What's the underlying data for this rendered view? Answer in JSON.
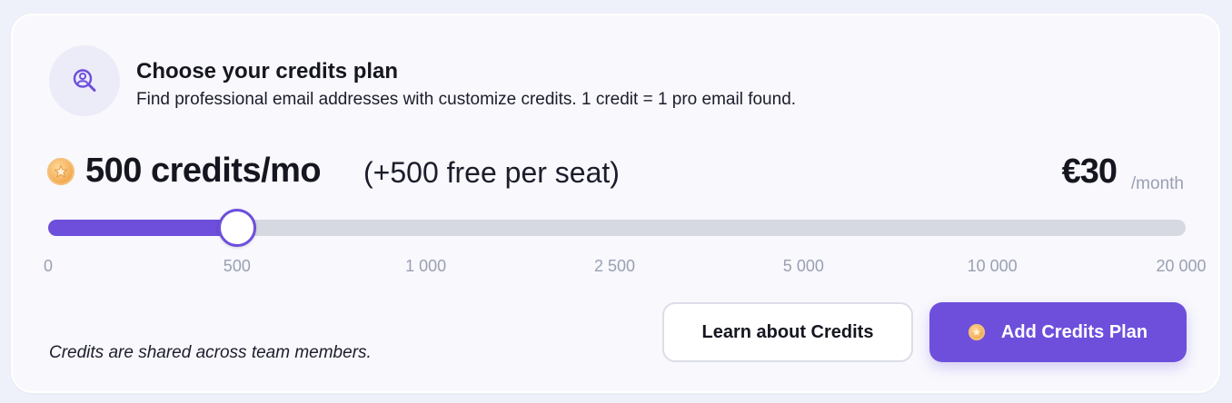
{
  "header": {
    "title": "Choose your credits plan",
    "subtitle": "Find professional email addresses with customize credits. 1 credit = 1 pro email found."
  },
  "plan": {
    "credits": "500 credits/mo",
    "free_per_seat": "(+500 free per seat)",
    "price": "€30",
    "period": "/month"
  },
  "slider": {
    "ticks": [
      "0",
      "500",
      "1 000",
      "2 500",
      "5 000",
      "10 000",
      "20 000"
    ],
    "selected_index": 1,
    "selected_value": 500
  },
  "footer": {
    "note": "Credits are shared across team members.",
    "learn_button": "Learn about Credits",
    "add_button": "Add Credits Plan"
  },
  "colors": {
    "accent": "#6d4fdc",
    "track": "#d6d8e2",
    "muted_text": "#9aa0b2",
    "coin": "#f0a64c"
  },
  "icons": {
    "header": "user-search-icon",
    "coin": "coin-icon"
  }
}
